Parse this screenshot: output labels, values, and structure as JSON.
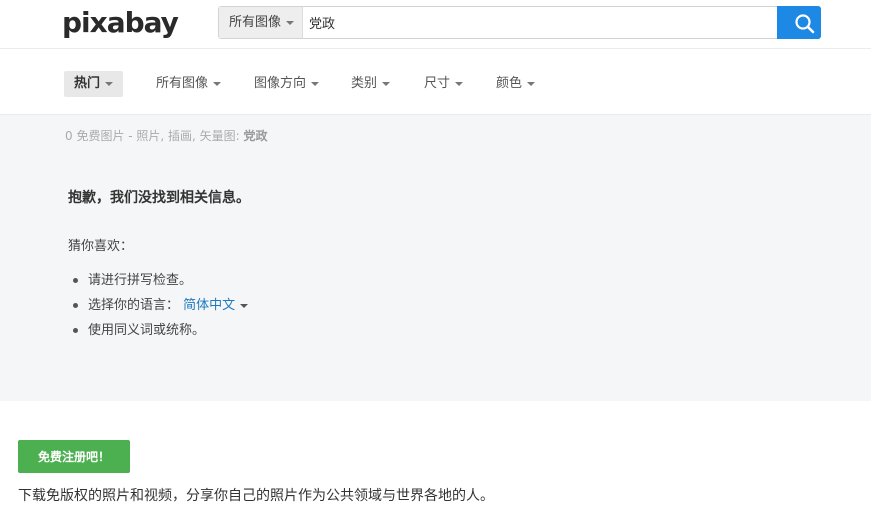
{
  "header": {
    "logo": "pixabay",
    "search": {
      "type_label": "所有图像",
      "query": "党政"
    }
  },
  "filters": [
    {
      "label": "热门",
      "active": true
    },
    {
      "label": "所有图像"
    },
    {
      "label": "图像方向"
    },
    {
      "label": "类别"
    },
    {
      "label": "尺寸"
    },
    {
      "label": "颜色"
    }
  ],
  "results": {
    "count_prefix": "0 免费图片 - 照片, 插画, 矢量图: ",
    "query": "党政",
    "sorry": "抱歉，我们没找到相关信息。",
    "guess_label": "猜你喜欢：",
    "tips": [
      "请进行拼写检查。",
      "选择你的语言：",
      "使用同义词或统称。"
    ],
    "language": "简体中文"
  },
  "footer": {
    "signup_label": "免费注册吧！",
    "tagline": "下载免版权的照片和视频，分享你自己的照片作为公共领域与世界各地的人。"
  }
}
